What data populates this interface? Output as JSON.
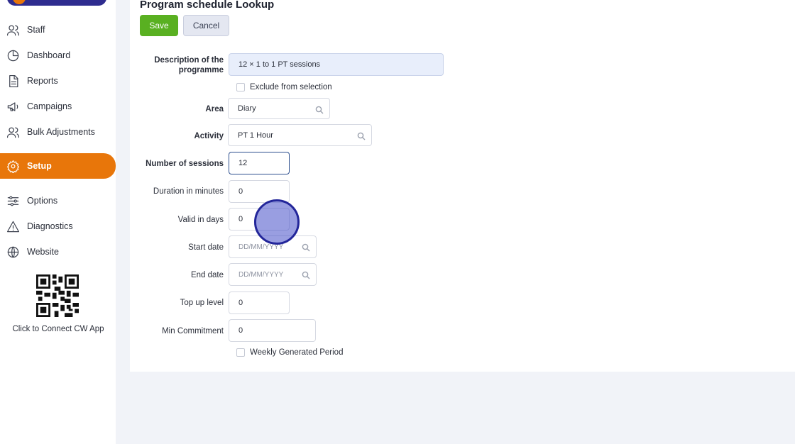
{
  "sidebar": {
    "items": [
      {
        "label": "Staff",
        "icon": "users-icon"
      },
      {
        "label": "Dashboard",
        "icon": "pie-chart-icon"
      },
      {
        "label": "Reports",
        "icon": "document-icon"
      },
      {
        "label": "Campaigns",
        "icon": "megaphone-icon"
      },
      {
        "label": "Bulk Adjustments",
        "icon": "users-icon"
      },
      {
        "label": "Setup",
        "icon": "gear-icon",
        "active": true
      },
      {
        "label": "Options",
        "icon": "sliders-icon"
      },
      {
        "label": "Diagnostics",
        "icon": "warning-icon"
      },
      {
        "label": "Website",
        "icon": "globe-icon"
      }
    ],
    "qr_caption": "Click to Connect CW App"
  },
  "page": {
    "title": "Program schedule Lookup",
    "save_label": "Save",
    "cancel_label": "Cancel"
  },
  "form": {
    "description": {
      "label": "Description of the programme",
      "value": "12 × 1 to 1 PT sessions"
    },
    "exclude": {
      "label": "Exclude from selection",
      "checked": false
    },
    "area": {
      "label": "Area",
      "value": "Diary"
    },
    "activity": {
      "label": "Activity",
      "value": "PT 1 Hour"
    },
    "sessions": {
      "label": "Number of sessions",
      "value": "12"
    },
    "duration": {
      "label": "Duration in minutes",
      "value": "0"
    },
    "valid_days": {
      "label": "Valid in days",
      "value": "0"
    },
    "start_date": {
      "label": "Start date",
      "placeholder": "DD/MM/YYYY"
    },
    "end_date": {
      "label": "End date",
      "placeholder": "DD/MM/YYYY"
    },
    "top_up": {
      "label": "Top up level",
      "value": "0"
    },
    "min_commitment": {
      "label": "Min Commitment",
      "value": "0"
    },
    "weekly": {
      "label": "Weekly Generated Period",
      "checked": false
    }
  },
  "colors": {
    "accent": "#e8760a",
    "save": "#59b021",
    "brand": "#2e2c8f"
  }
}
